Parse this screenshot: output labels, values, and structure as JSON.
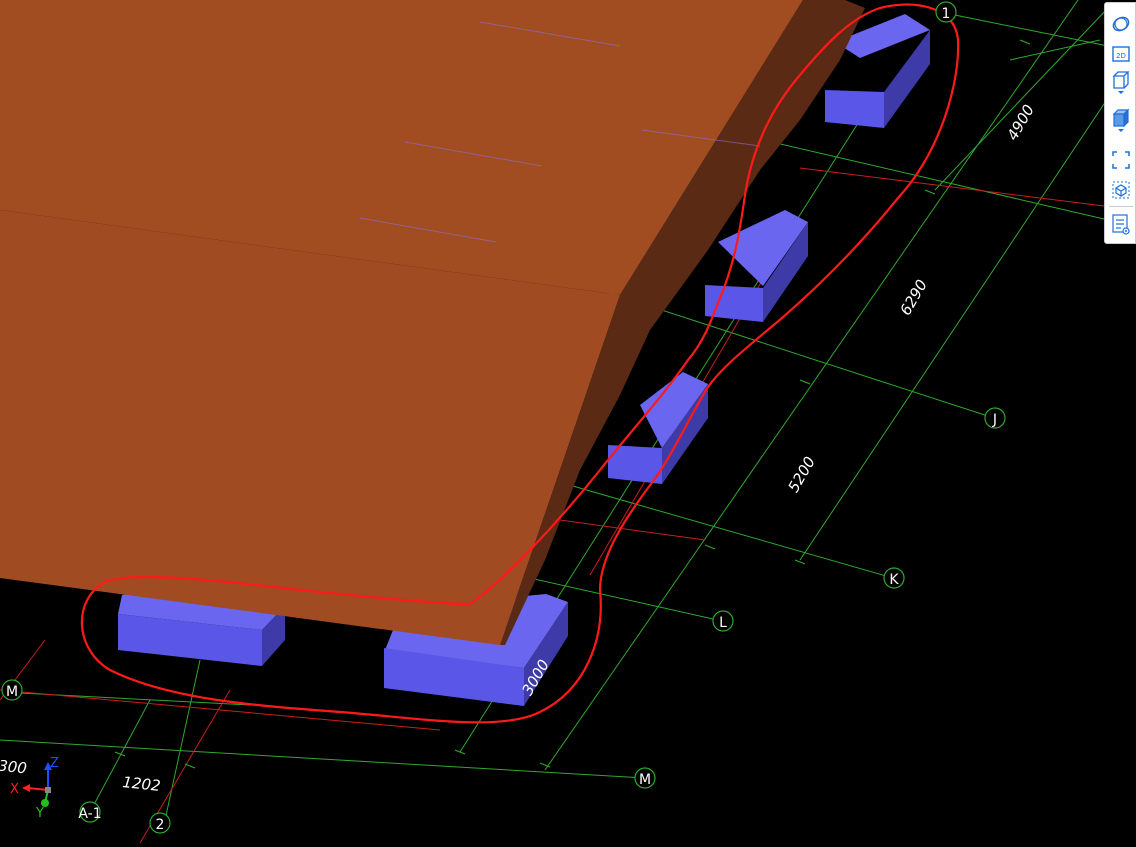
{
  "colors": {
    "background": "#000000",
    "grid_line": "#2fa82f",
    "axis_line": "#c81e1e",
    "slab_top": "#a24c22",
    "slab_side": "#5a2a14",
    "slab_front": "#9a4520",
    "footing_top": "#6a66f0",
    "footing_front": "#5a56e8",
    "footing_side": "#3e3aa8",
    "markup": "#ff1a1a",
    "toolbar_icon": "#1e6fd9"
  },
  "grid_labels": {
    "grid_1": "1",
    "grid_j": "J",
    "grid_k": "K",
    "grid_l": "L",
    "grid_m_left": "M",
    "grid_m_bottom": "M",
    "grid_2": "2"
  },
  "dimensions": {
    "dim_4900": "4900",
    "dim_6290": "6290",
    "dim_5200": "5200",
    "dim_1202": "1202",
    "dim_300": "300",
    "dim_3000": "3000"
  },
  "view_label": "A-1",
  "axis_gizmo": {
    "x": "X",
    "y": "Y",
    "z": "Z"
  },
  "toolbar": {
    "icons": [
      "orbit-icon",
      "view-2d-icon",
      "cube-wireframe-icon",
      "cube-shaded-icon",
      "fit-extents-icon",
      "isolate-object-icon",
      "properties-list-icon"
    ],
    "view_2d_label": "2D"
  }
}
